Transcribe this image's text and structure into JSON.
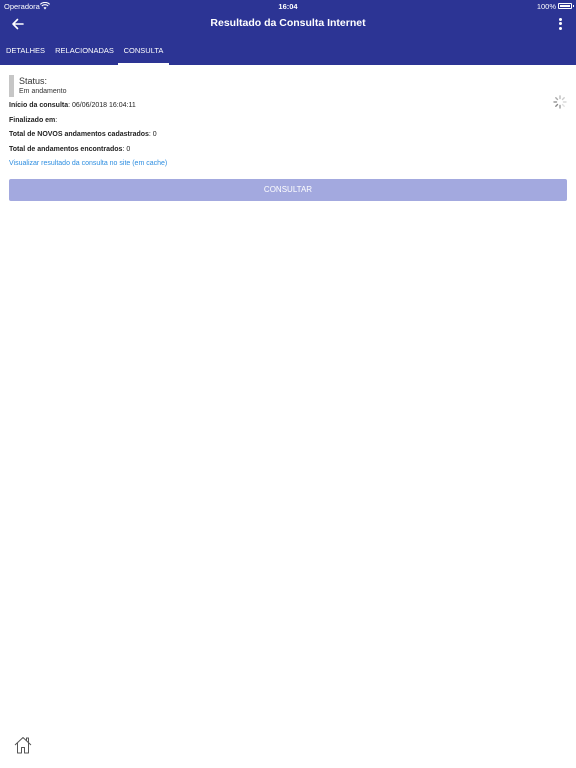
{
  "statusbar": {
    "carrier": "Operadora",
    "time": "16:04",
    "battery": "100%"
  },
  "header": {
    "title": "Resultado da Consulta Internet"
  },
  "tabs": [
    {
      "label": "DETALHES",
      "active": false
    },
    {
      "label": "RELACIONADAS",
      "active": false
    },
    {
      "label": "CONSULTA",
      "active": true
    }
  ],
  "status": {
    "label": "Status:",
    "value": "Em andamento"
  },
  "details": {
    "inicio_label": "Início da consulta",
    "inicio_value": ": 06/06/2018 16:04:11",
    "finalizado_label": "Finalizado em",
    "finalizado_value": ":",
    "novos_label": "Total de NOVOS andamentos cadastrados",
    "novos_value": ": 0",
    "encontrados_label": "Total de andamentos encontrados",
    "encontrados_value": ": 0"
  },
  "link": {
    "label": "Visualizar resultado da consulta no site (em cache)"
  },
  "actions": {
    "consultar_label": "CONSULTAR"
  },
  "colors": {
    "header": "#2c3494",
    "button": "#a3a9df",
    "link": "#2c8de0"
  },
  "icons": [
    "wifi-icon",
    "battery-icon",
    "back-arrow-icon",
    "more-vertical-icon",
    "loading-spinner-icon",
    "home-icon"
  ]
}
